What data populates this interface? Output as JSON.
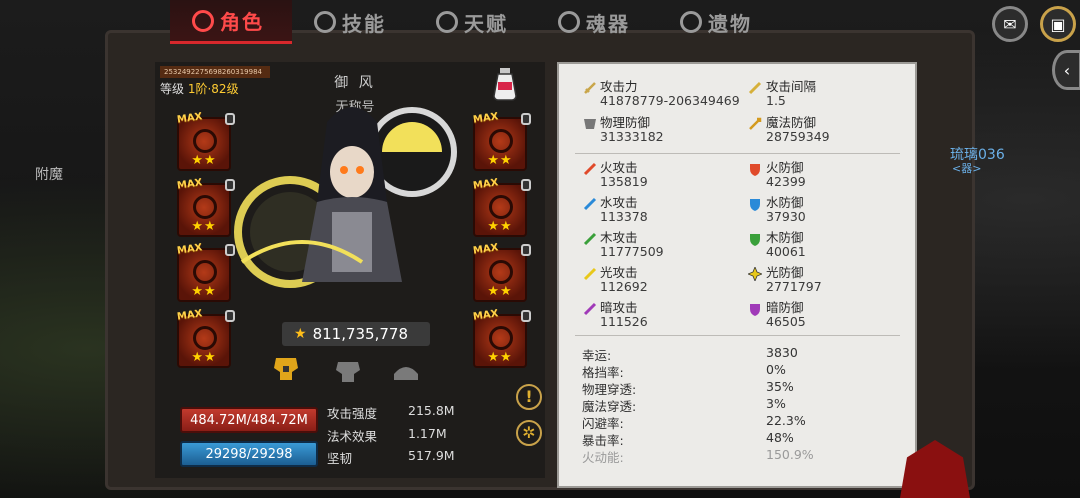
{
  "tabs": [
    {
      "label": "角色",
      "icon": "character-icon",
      "active": true
    },
    {
      "label": "技能",
      "icon": "skill-icon",
      "active": false
    },
    {
      "label": "天赋",
      "icon": "talent-icon",
      "active": false
    },
    {
      "label": "魂器",
      "icon": "soul-vessel-icon",
      "active": false
    },
    {
      "label": "遗物",
      "icon": "relic-icon",
      "active": false
    }
  ],
  "side": {
    "left_label": "附魔",
    "right_label": "琉璃036",
    "right_sublabel": "<器>"
  },
  "character": {
    "id_text": "2532492275698260319984",
    "level_prefix": "等级",
    "level_value": "1阶·82级",
    "name": "御 风",
    "title": "无称号",
    "power": "811,735,778"
  },
  "equipment": {
    "max_label": "MAX",
    "stars": "★★",
    "slots_left": [
      "helmet",
      "shoulder",
      "armor",
      "amulet"
    ],
    "slots_right": [
      "weapon",
      "gloves",
      "boots",
      "ring"
    ]
  },
  "vitals": {
    "hp": "484.72M/484.72M",
    "mp": "29298/29298",
    "stats": [
      {
        "label": "攻击强度",
        "value": "215.8M"
      },
      {
        "label": "法术效果",
        "value": "1.17M"
      },
      {
        "label": "坚韧",
        "value": "517.9M"
      }
    ]
  },
  "stats": {
    "main": [
      {
        "name": "攻击力",
        "value": "41878779-206349469",
        "icon": "sword-icon",
        "color": "#c9a64a"
      },
      {
        "name": "攻击间隔",
        "value": "1.5",
        "icon": "speed-icon",
        "color": "#d6b03a"
      },
      {
        "name": "物理防御",
        "value": "31333182",
        "icon": "armor-icon",
        "color": "#777777"
      },
      {
        "name": "魔法防御",
        "value": "28759349",
        "icon": "magic-shield-icon",
        "color": "#d49a1e"
      }
    ],
    "elements": [
      {
        "atk_name": "火攻击",
        "atk": "135819",
        "def_name": "火防御",
        "def": "42399",
        "color": "#e04a2a"
      },
      {
        "atk_name": "水攻击",
        "atk": "113378",
        "def_name": "水防御",
        "def": "37930",
        "color": "#2a8ad8"
      },
      {
        "atk_name": "木攻击",
        "atk": "11777509",
        "def_name": "木防御",
        "def": "40061",
        "color": "#3aa03a"
      },
      {
        "atk_name": "光攻击",
        "atk": "112692",
        "def_name": "光防御",
        "def": "2771797",
        "color": "#e8c81a"
      },
      {
        "atk_name": "暗攻击",
        "atk": "111526",
        "def_name": "暗防御",
        "def": "46505",
        "color": "#a03ab8"
      }
    ],
    "misc": [
      {
        "name": "幸运:",
        "value": "3830"
      },
      {
        "name": "格挡率:",
        "value": "0%"
      },
      {
        "name": "物理穿透:",
        "value": "35%"
      },
      {
        "name": "魔法穿透:",
        "value": "3%"
      },
      {
        "name": "闪避率:",
        "value": "22.3%"
      },
      {
        "name": "暴击率:",
        "value": "48%"
      },
      {
        "name": "火动能:",
        "value": "150.9%"
      }
    ]
  }
}
